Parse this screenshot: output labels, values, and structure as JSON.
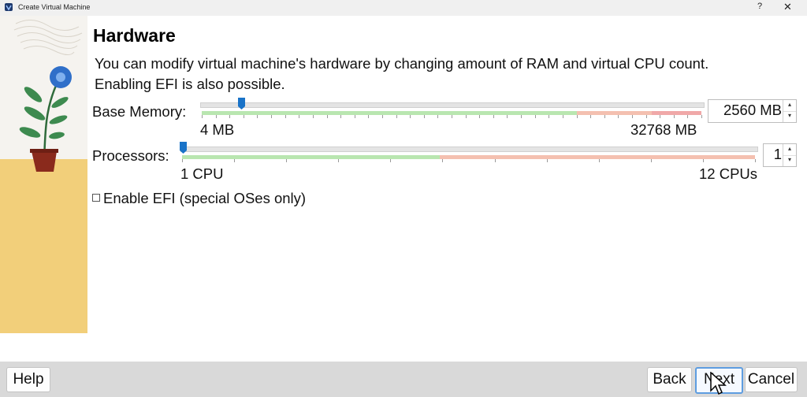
{
  "window": {
    "title": "Create Virtual Machine",
    "help_glyph": "?",
    "close_glyph": "✕"
  },
  "page": {
    "heading": "Hardware",
    "description": "You can modify virtual machine's hardware by changing amount of RAM and virtual CPU count. Enabling EFI is also possible."
  },
  "memory": {
    "label": "Base Memory:",
    "min_label": "4 MB",
    "max_label": "32768 MB",
    "value_text": "2560 MB",
    "value": 2560,
    "min": 4,
    "max": 32768,
    "spin_up": "▴",
    "spin_down": "▾"
  },
  "processors": {
    "label": "Processors:",
    "min_label": "1 CPU",
    "max_label": "12 CPUs",
    "value_text": "1",
    "value": 1,
    "min": 1,
    "max": 12,
    "spin_up": "▴",
    "spin_down": "▾"
  },
  "efi": {
    "label": "Enable EFI (special OSes only)",
    "checked": false
  },
  "buttons": {
    "help": "Help",
    "back": "Back",
    "next": "Next",
    "cancel": "Cancel"
  },
  "colors": {
    "green_zone": "#b9e6b0",
    "orange_zone": "#f4c0b0",
    "red_zone": "#f0a8a8",
    "thumb": "#1a73c8",
    "floor": "#f2cf7a",
    "accent": "#5e9de0"
  }
}
